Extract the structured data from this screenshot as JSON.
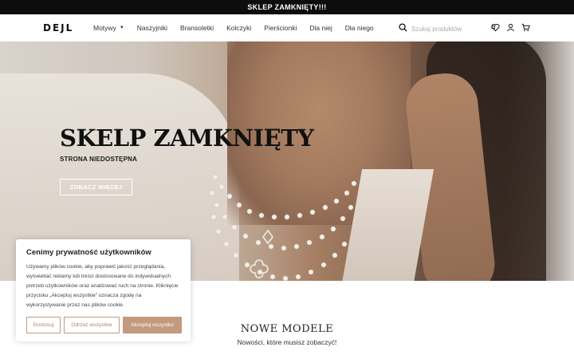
{
  "announcement": "SKLEP ZAMKNIĘTY!!!",
  "header": {
    "logo": "DEJL",
    "nav": [
      {
        "label": "Motywy",
        "has_dropdown": true
      },
      {
        "label": "Naszyjniki"
      },
      {
        "label": "Bransoletki"
      },
      {
        "label": "Kolczyki"
      },
      {
        "label": "Pierścionki"
      },
      {
        "label": "Dla niej"
      },
      {
        "label": "Dla niego"
      }
    ],
    "search_placeholder": "Szukaj produktów",
    "icons": [
      "wishlist-icon",
      "user-icon",
      "cart-icon"
    ]
  },
  "hero": {
    "title": "SKELP ZAMKNIĘTY",
    "subtitle": "STRONA NIEDOSTĘPNA",
    "button_label": "ZOBACZ WIĘCEJ"
  },
  "section": {
    "title": "NOWE MODELE",
    "subtitle": "Nowości, które musisz zobaczyć!"
  },
  "cookie": {
    "title": "Cenimy prywatność użytkowników",
    "text": "Używamy plików cookie, aby poprawić jakość przeglądania, wyświetlać reklamy lub treści dostosowane do indywidualnych potrzeb użytkowników oraz analizować ruch na stronie. Kliknięcie przycisku „Akceptuj wszystkie” oznacza zgodę na wykorzystywanie przez nas plików cookie.",
    "btn_customize": "Dostosuj",
    "btn_reject": "Odrzuć wszystkie",
    "btn_accept": "Akceptuj wszystko"
  },
  "colors": {
    "accent": "#c39a7e",
    "topbar": "#0d0d0d"
  }
}
